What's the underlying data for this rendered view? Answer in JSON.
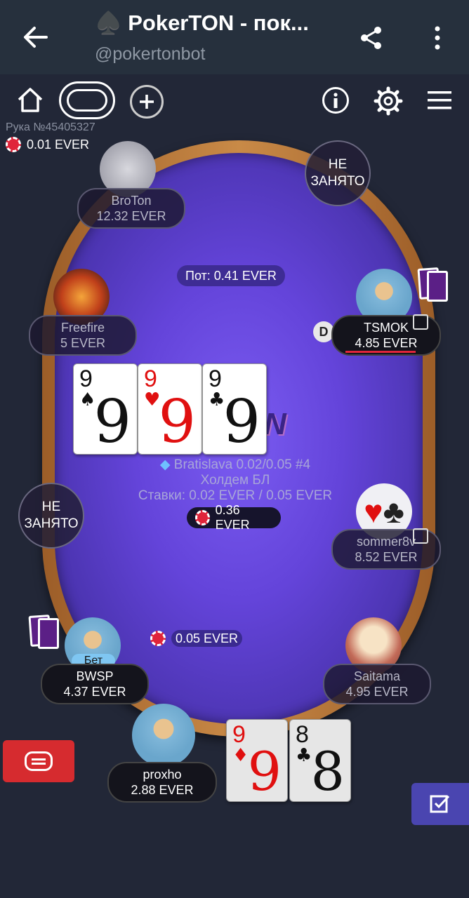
{
  "telegram": {
    "title": "♠️ PokerTON - пок...",
    "subtitle": "@pokertonbot"
  },
  "hand": {
    "number": "Рука №45405327",
    "ante": "0.01 EVER"
  },
  "pot": "Пот: 0.41 EVER",
  "table_info": {
    "name": "Bratislava 0.02/0.05 #4",
    "game": "Холдем  БЛ",
    "stakes": "Ставки: 0.02 EVER / 0.05 EVER",
    "center_bet": "0.36 EVER"
  },
  "community_cards": [
    {
      "rank": "9",
      "suit": "♠",
      "color": "#111111"
    },
    {
      "rank": "9",
      "suit": "♥",
      "color": "#e01010"
    },
    {
      "rank": "9",
      "suit": "♣",
      "color": "#111111"
    }
  ],
  "hero_cards": [
    {
      "rank": "9",
      "suit": "♦",
      "color": "#e01010"
    },
    {
      "rank": "8",
      "suit": "♣",
      "color": "#111111"
    }
  ],
  "empty_seat_label_1": "НЕ",
  "empty_seat_label_2": "ЗАНЯТО",
  "dealer_button": "D",
  "players": {
    "broton": {
      "name": "BroTon",
      "stack": "12.32 EVER"
    },
    "freefire": {
      "name": "Freefire",
      "stack": "5 EVER"
    },
    "tsmok": {
      "name": "TSMOK",
      "stack": "4.85 EVER"
    },
    "sommer": {
      "name": "sommer8v",
      "stack": "8.52 EVER"
    },
    "bwsp": {
      "name": "BWSP",
      "stack": "4.37 EVER",
      "badge": "Бет",
      "bet": "0.05 EVER"
    },
    "saitama": {
      "name": "Saitama",
      "stack": "4.95 EVER"
    },
    "proxho": {
      "name": "proxho",
      "stack": "2.88 EVER"
    }
  },
  "colors": {
    "felt": "#6444da",
    "rail": "#c98a47",
    "header": "#26303d",
    "background": "#222737",
    "chat_button": "#d62b2f",
    "check_button": "#4a45b0"
  }
}
